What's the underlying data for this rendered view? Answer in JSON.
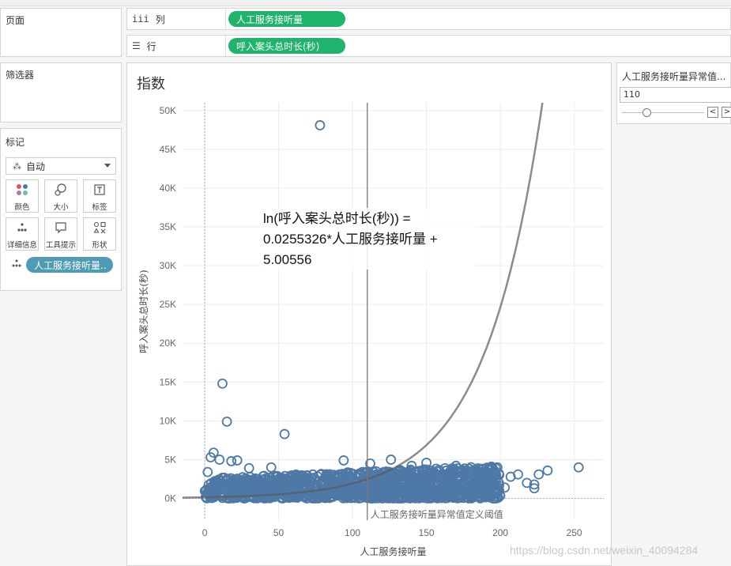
{
  "left": {
    "pages_title": "页面",
    "filters_title": "筛选器",
    "marks_title": "标记",
    "mark_type": "自动",
    "buttons": [
      {
        "label": "颜色",
        "icon": "color-dots-icon"
      },
      {
        "label": "大小",
        "icon": "size-icon"
      },
      {
        "label": "标签",
        "icon": "label-icon"
      },
      {
        "label": "详细信息",
        "icon": "detail-icon"
      },
      {
        "label": "工具提示",
        "icon": "tooltip-icon"
      },
      {
        "label": "形状",
        "icon": "shape-icon"
      }
    ],
    "detail_pill": "人工服务接听量.."
  },
  "shelves": {
    "columns_label": "列",
    "columns_pill": "人工服务接听量",
    "rows_label": "行",
    "rows_pill": "呼入案头总时长(秒)"
  },
  "param": {
    "title": "人工服务接听量异常值...",
    "value": "110",
    "prev": "<",
    "next": ">"
  },
  "chart_data": {
    "type": "scatter",
    "title": "指数",
    "xlabel": "人工服务接听量",
    "ylabel": "呼入案头总时长(秒)",
    "xlim": [
      -15,
      270
    ],
    "ylim": [
      -2800,
      51000
    ],
    "xticks": [
      0,
      50,
      100,
      150,
      200,
      250
    ],
    "xtick_labels": [
      "0",
      "50",
      "100",
      "150",
      "200",
      "250"
    ],
    "yticks": [
      0,
      5000,
      10000,
      15000,
      20000,
      25000,
      30000,
      35000,
      40000,
      45000,
      50000
    ],
    "ytick_labels": [
      "0K",
      "5K",
      "10K",
      "15K",
      "20K",
      "25K",
      "30K",
      "35K",
      "40K",
      "45K",
      "50K"
    ],
    "grid": true,
    "marker_color": "#4e79a7",
    "trend": {
      "coef": 0.0255326,
      "intercept": 5.00556,
      "equation_text": "ln(呼入案头总时长(秒)) =\n0.0255326*人工服务接听量 +\n5.00556"
    },
    "reference_line": {
      "x": 110,
      "label": "人工服务接听量异常值定义阈值"
    },
    "outliers": [
      {
        "x": 78,
        "y": 48100
      },
      {
        "x": 12,
        "y": 14800
      },
      {
        "x": 15,
        "y": 9900
      },
      {
        "x": 54,
        "y": 8300
      },
      {
        "x": 6,
        "y": 5900
      },
      {
        "x": 4,
        "y": 5300
      },
      {
        "x": 10,
        "y": 5000
      },
      {
        "x": 18,
        "y": 4800
      },
      {
        "x": 22,
        "y": 4900
      },
      {
        "x": 94,
        "y": 4900
      },
      {
        "x": 126,
        "y": 5000
      },
      {
        "x": 150,
        "y": 4600
      },
      {
        "x": 197,
        "y": 3900
      },
      {
        "x": 207,
        "y": 2800
      },
      {
        "x": 212,
        "y": 3100
      },
      {
        "x": 218,
        "y": 2000
      },
      {
        "x": 223,
        "y": 1800
      },
      {
        "x": 226,
        "y": 3100
      },
      {
        "x": 232,
        "y": 3600
      },
      {
        "x": 253,
        "y": 4000
      },
      {
        "x": 203,
        "y": 1400
      },
      {
        "x": 223,
        "y": 1300
      },
      {
        "x": 170,
        "y": 4200
      },
      {
        "x": 185,
        "y": 3500
      },
      {
        "x": 140,
        "y": 4200
      },
      {
        "x": 112,
        "y": 4500
      },
      {
        "x": 2,
        "y": 3400
      },
      {
        "x": 30,
        "y": 3900
      },
      {
        "x": 45,
        "y": 4000
      }
    ],
    "cluster": {
      "x_min": 0,
      "x_max": 200,
      "y_max_base": 2600,
      "y_max_slope": 8,
      "count": 1400
    }
  },
  "watermark": "https://blog.csdn.net/weixin_40094284"
}
